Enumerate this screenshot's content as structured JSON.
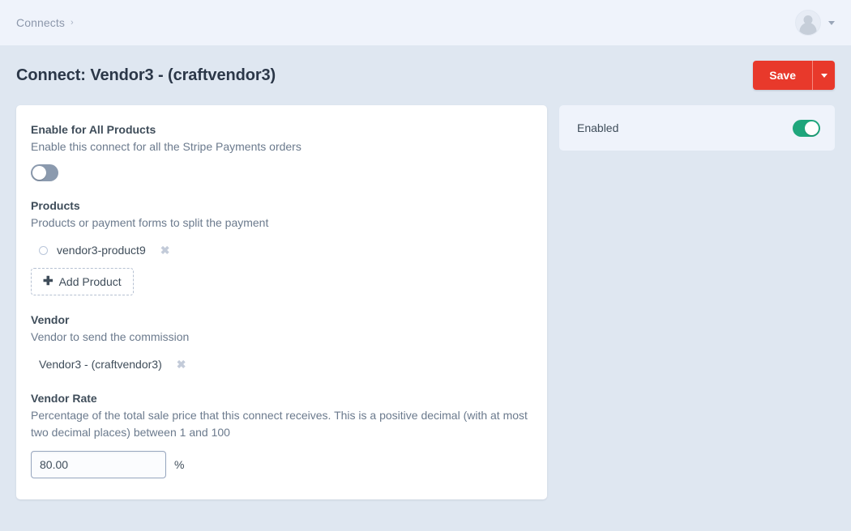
{
  "topbar": {
    "breadcrumb": {
      "label": "Connects",
      "separator": "›"
    },
    "account": {
      "avatar_icon": "user-avatar-icon",
      "caret_icon": "chevron-down-icon"
    }
  },
  "header": {
    "title": "Connect: Vendor3 - (craftvendor3)",
    "save_label": "Save",
    "save_menu_icon": "chevron-down-icon",
    "save_color": "#e8392b"
  },
  "main": {
    "enable_all_products": {
      "label": "Enable for All Products",
      "instructions": "Enable this connect for all the Stripe Payments orders",
      "toggle_state": "off",
      "toggle_name": "enable-for-all-products-toggle"
    },
    "products": {
      "label": "Products",
      "instructions": "Products or payment forms to split the payment",
      "items": [
        {
          "title": "vendor3-product9",
          "thumb_icon": "circle-thumbnail-icon",
          "delete_icon": "✖"
        }
      ],
      "add_button_label": "Add Product",
      "add_button_icon": "✚"
    },
    "vendor": {
      "label": "Vendor",
      "instructions": "Vendor to send the commission",
      "items": [
        {
          "title": "Vendor3 - (craftvendor3)",
          "delete_icon": "✖"
        }
      ]
    },
    "vendor_rate": {
      "label": "Vendor Rate",
      "instructions": "Percentage of the total sale price that this connect receives. This is a positive decimal (with at most two decimal places) between 1 and 100",
      "value": "80.00",
      "placeholder": "",
      "suffix": "%"
    }
  },
  "sidebar": {
    "enabled": {
      "label": "Enabled",
      "toggle_state": "on",
      "toggle_name": "enabled-toggle",
      "on_color": "#1fa67c"
    }
  }
}
